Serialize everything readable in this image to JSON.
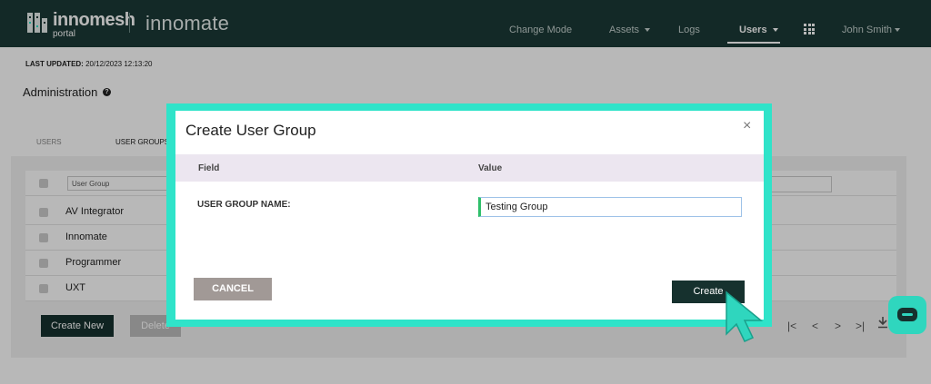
{
  "header": {
    "logo_name": "innomesh",
    "logo_sub": "portal",
    "brand": "innomate",
    "nav": [
      "Change Mode",
      "Assets",
      "Logs",
      "Users"
    ],
    "user": "John Smith"
  },
  "page": {
    "last_updated_label": "LAST UPDATED:",
    "last_updated_value": "20/12/2023 12:13:20",
    "title": "Administration",
    "help": "?",
    "tabs": [
      "USERS",
      "USER GROUPS"
    ],
    "filter_placeholder": "User Group",
    "rows": [
      "AV Integrator",
      "Innomate",
      "Programmer",
      "UXT"
    ],
    "create_new": "Create New",
    "delete": "Delete",
    "pager": [
      "|<",
      "<",
      ">",
      ">|"
    ]
  },
  "modal": {
    "title": "Create User Group",
    "close": "×",
    "col_field": "Field",
    "col_value": "Value",
    "field_label": "USER GROUP NAME:",
    "field_value": "Testing Group",
    "cancel": "CANCEL",
    "create": "Create"
  },
  "colors": {
    "nav_bg": "#1b3a36",
    "accent": "#2fe3c9",
    "primary_button": "#16312e",
    "cancel_button": "#a19996",
    "table_header": "#ece6f0"
  }
}
